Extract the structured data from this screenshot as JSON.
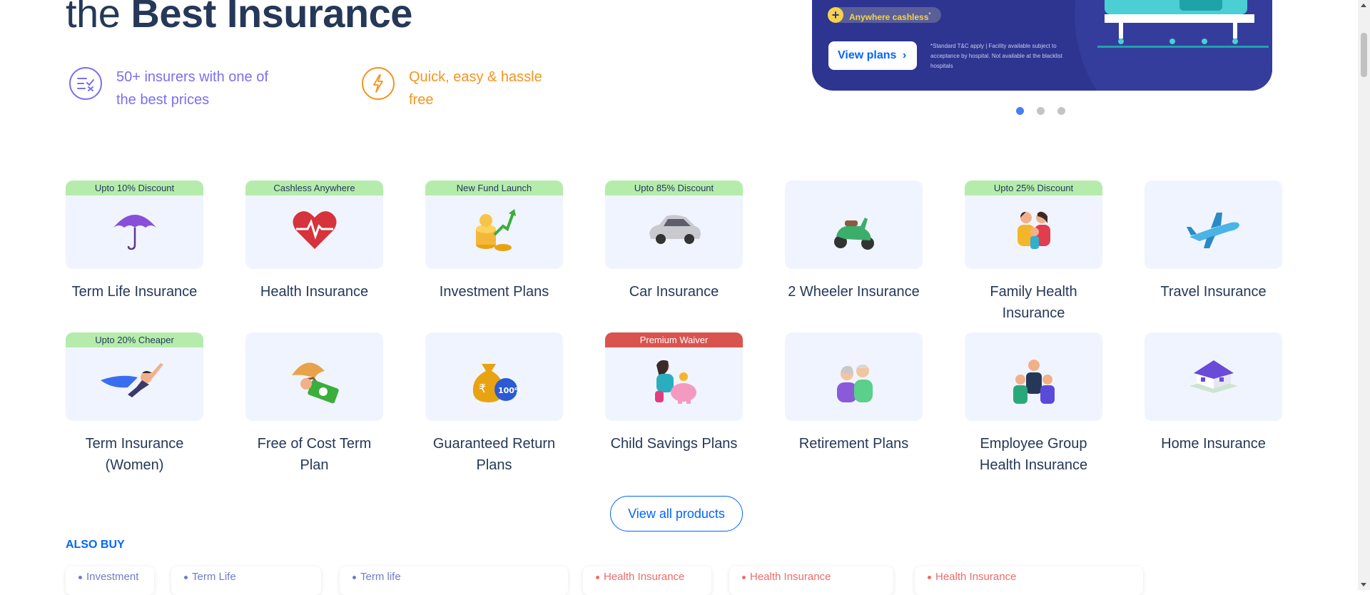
{
  "hero": {
    "title_light": "the ",
    "title_bold": "Best Insurance",
    "features": [
      {
        "text": "50+ insurers with one of the best prices",
        "icon": "checklist-icon",
        "color": "#7a6ff0"
      },
      {
        "text": "Quick, easy & hassle free",
        "icon": "lightning-icon",
        "color": "#f5941e"
      }
    ]
  },
  "banner": {
    "cashless_label": "Anywhere cashless",
    "cashless_sup": "*",
    "view_plans_label": "View plans",
    "view_plans_chevron": "›",
    "terms": "*Standard T&C apply | Facility available subject to acceptance by hospital. Not available at the blacklist hospitals",
    "slide_count": 3,
    "active_slide": 1
  },
  "products": [
    {
      "name": "Term Life Insurance",
      "badge": "Upto 10% Discount",
      "badge_style": "green",
      "icon": "umbrella-icon"
    },
    {
      "name": "Health Insurance",
      "badge": "Cashless Anywhere",
      "badge_style": "green",
      "icon": "heart-pulse-icon"
    },
    {
      "name": "Investment Plans",
      "badge": "New Fund Launch",
      "badge_style": "green",
      "icon": "coins-growth-icon"
    },
    {
      "name": "Car Insurance",
      "badge": "Upto 85% Discount",
      "badge_style": "green",
      "icon": "car-icon"
    },
    {
      "name": "2 Wheeler Insurance",
      "badge": "",
      "badge_style": "",
      "icon": "scooter-icon"
    },
    {
      "name": "Family Health Insurance",
      "badge": "Upto 25% Discount",
      "badge_style": "green",
      "icon": "family-icon"
    },
    {
      "name": "Travel Insurance",
      "badge": "",
      "badge_style": "",
      "icon": "airplane-icon"
    },
    {
      "name": "Term Insurance (Women)",
      "badge": "Upto 20% Cheaper",
      "badge_style": "green",
      "icon": "superwoman-icon"
    },
    {
      "name": "Free of Cost Term Plan",
      "badge": "",
      "badge_style": "",
      "icon": "umbrella-money-icon"
    },
    {
      "name": "Guaranteed Return Plans",
      "badge": "",
      "badge_style": "",
      "icon": "money-bag-icon"
    },
    {
      "name": "Child Savings Plans",
      "badge": "Premium Waiver",
      "badge_style": "red",
      "icon": "child-piggy-bank-icon"
    },
    {
      "name": "Retirement Plans",
      "badge": "",
      "badge_style": "",
      "icon": "elderly-couple-icon"
    },
    {
      "name": "Employee Group Health Insurance",
      "badge": "",
      "badge_style": "",
      "icon": "group-people-icon"
    },
    {
      "name": "Home Insurance",
      "badge": "",
      "badge_style": "",
      "icon": "house-icon"
    }
  ],
  "view_all_label": "View all products",
  "also_buy": {
    "heading": "ALSO BUY",
    "chips": [
      {
        "label": "Investment",
        "color": "blue"
      },
      {
        "label": "Term Life",
        "color": "blue"
      },
      {
        "label": "Term life",
        "color": "blue"
      },
      {
        "label": "Health Insurance",
        "color": "red"
      },
      {
        "label": "Health Insurance",
        "color": "red"
      },
      {
        "label": "Health Insurance",
        "color": "red"
      }
    ]
  },
  "colors": {
    "primary_blue": "#0065ff",
    "heading_navy": "#253858",
    "badge_green": "#b5ecac",
    "badge_red": "#d9534f",
    "card_bg": "#f0f4fe",
    "banner_navy": "#2d3590"
  }
}
